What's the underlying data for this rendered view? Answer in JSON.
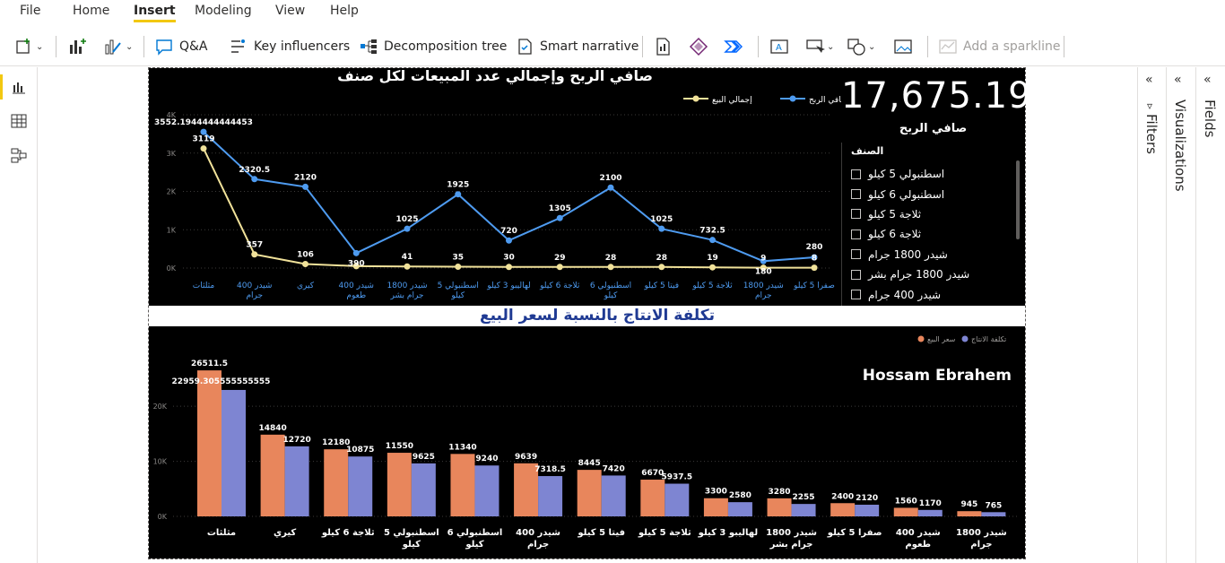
{
  "menu": {
    "tabs": [
      {
        "label": "File"
      },
      {
        "label": "Home"
      },
      {
        "label": "Insert"
      },
      {
        "label": "Modeling"
      },
      {
        "label": "View"
      },
      {
        "label": "Help"
      }
    ]
  },
  "ribbon": {
    "qa_label": "Q&A",
    "key_influencers_label": "Key influencers",
    "decomposition_label": "Decomposition tree",
    "smart_narrative_label": "Smart narrative",
    "sparkline_label": "Add a sparkline"
  },
  "panes": {
    "filters_label": "Filters",
    "visualizations_label": "Visualizations",
    "fields_label": "Fields"
  },
  "colors": {
    "accent": "#f2c811",
    "profit_line": "#4e9bf0",
    "sales_line": "#f1e29a",
    "sale_price_bar": "#e8865c",
    "cost_bar": "#7e85d2",
    "subtitle_blue": "#1f3a93"
  },
  "line_chart": {
    "title": "صافي الربح وإجمالي عدد المبيعات لكل صنف",
    "legend": [
      "صافي الربح",
      "إجمالي البيع"
    ],
    "y_ticks": [
      "0K",
      "1K",
      "2K",
      "3K",
      "4K"
    ]
  },
  "card": {
    "value": "17,675.19",
    "label": "صافي الربح"
  },
  "slicer": {
    "title": "الصنف",
    "items": [
      "اسطنبولي 5 كيلو",
      "اسطنبولي 6 كيلو",
      "ثلاجة 5 كيلو",
      "ثلاجة 6 كيلو",
      "شيدر 1800 جرام",
      "شيدر 1800 جرام بشر",
      "شيدر 400 جرام"
    ]
  },
  "subtitle": "تكلفة الانتاج بالنسبة لسعر البيع",
  "bar_chart": {
    "legend": [
      "سعر البيع",
      "تكلفة الانتاج"
    ],
    "author": "Hossam Ebrahem",
    "y_ticks": [
      "0K",
      "10K",
      "20K"
    ]
  },
  "chart_data": [
    {
      "type": "line",
      "title": "صافي الربح وإجمالي عدد المبيعات لكل صنف",
      "categories": [
        [
          "مثلثات"
        ],
        [
          "شيدر 400",
          "جرام"
        ],
        [
          "كيري"
        ],
        [
          "شيدر 400",
          "طعوم"
        ],
        [
          "شيدر 1800",
          "جرام بشر"
        ],
        [
          "اسطنبولي 5",
          "كيلو"
        ],
        [
          "لهاليبو 3 كيلو"
        ],
        [
          "ثلاجة 6 كيلو"
        ],
        [
          "اسطنبولي 6",
          "كيلو"
        ],
        [
          "فيتا 5 كيلو"
        ],
        [
          "ثلاجة 5 كيلو"
        ],
        [
          "شيدر 1800",
          "جرام"
        ],
        [
          "صفرا 5 كيلو"
        ]
      ],
      "series": [
        {
          "name": "صافي الربح",
          "values": [
            3552.1944444444453,
            2320.5,
            2120,
            390,
            1025,
            1925,
            720,
            1305,
            2100,
            1025,
            732.5,
            180,
            280
          ],
          "labels": [
            "3552.1944444444453",
            "2320.5",
            "2120",
            "390",
            "1025",
            "1925",
            "720",
            "1305",
            "2100",
            "1025",
            "732.5",
            "180",
            "280"
          ]
        },
        {
          "name": "إجمالي البيع",
          "values": [
            3119,
            357,
            106,
            50,
            41,
            35,
            30,
            29,
            28,
            28,
            19,
            9,
            8
          ],
          "labels": [
            "3119",
            "357",
            "106",
            "",
            "41",
            "35",
            "30",
            "29",
            "28",
            "28",
            "19",
            "9",
            "8"
          ]
        }
      ],
      "ylim": [
        0,
        4000
      ],
      "grid": true,
      "legend_position": "top-right"
    },
    {
      "type": "bar",
      "categories": [
        [
          "مثلثات"
        ],
        [
          "كيري"
        ],
        [
          "ثلاجة 6 كيلو"
        ],
        [
          "اسطنبولي 5",
          "كيلو"
        ],
        [
          "اسطنبولي 6",
          "كيلو"
        ],
        [
          "شيدر 400",
          "جرام"
        ],
        [
          "فيتا 5 كيلو"
        ],
        [
          "ثلاجة 5 كيلو"
        ],
        [
          "لهاليبو 3 كيلو"
        ],
        [
          "شيدر 1800",
          "جرام بشر"
        ],
        [
          "صفرا 5 كيلو"
        ],
        [
          "شيدر 400",
          "طعوم"
        ],
        [
          "شيدر 1800",
          "جرام"
        ]
      ],
      "series": [
        {
          "name": "سعر البيع",
          "values": [
            26511.5,
            14840,
            12180,
            11550,
            11340,
            9639,
            8445,
            6670,
            3300,
            3280,
            2400,
            1560,
            945
          ],
          "labels": [
            "26511.5",
            "14840",
            "12180",
            "11550",
            "11340",
            "9639",
            "8445",
            "6670",
            "3300",
            "3280",
            "2400",
            "1560",
            "945"
          ]
        },
        {
          "name": "تكلفة الانتاج",
          "values": [
            22959.305555555555,
            12720,
            10875,
            9625,
            9240,
            7318.5,
            7420,
            5937.5,
            2580,
            2255,
            2120,
            1170,
            765
          ],
          "labels": [
            "22959.305555555555",
            "12720",
            "10875",
            "9625",
            "9240",
            "7318.5",
            "7420",
            "5937.5",
            "2580",
            "2255",
            "2120",
            "1170",
            "765"
          ]
        }
      ],
      "ylim": [
        0,
        28000
      ],
      "grid": true,
      "legend_position": "top-right"
    }
  ]
}
